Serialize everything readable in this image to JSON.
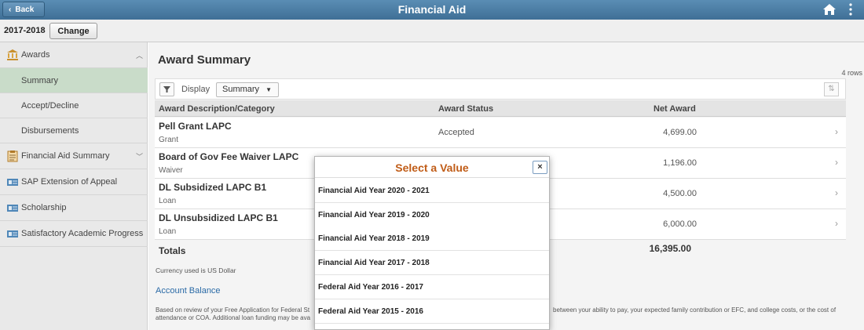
{
  "header": {
    "back_label": "Back",
    "title": "Financial Aid",
    "home_icon": "home-icon",
    "menu_icon": "kebab-menu-icon"
  },
  "yearbar": {
    "year": "2017-2018",
    "change_label": "Change"
  },
  "sidebar": {
    "awards_label": "Awards",
    "sub_items": [
      "Summary",
      "Accept/Decline",
      "Disbursements"
    ],
    "items": [
      "Financial Aid Summary",
      "SAP Extension of Appeal",
      "Scholarship",
      "Satisfactory Academic Progress"
    ]
  },
  "main": {
    "title": "Award Summary",
    "rows_count": "4 rows",
    "display_label": "Display",
    "display_value": "Summary",
    "columns": [
      "Award Description/Category",
      "Award Status",
      "Net Award"
    ],
    "rows": [
      {
        "desc": "Pell Grant LAPC",
        "cat": "Grant",
        "status": "Accepted",
        "amount": "4,699.00"
      },
      {
        "desc": "Board of Gov Fee Waiver LAPC",
        "cat": "Waiver",
        "status": "",
        "amount": "1,196.00"
      },
      {
        "desc": "DL Subsidized LAPC B1",
        "cat": "Loan",
        "status": "",
        "amount": "4,500.00"
      },
      {
        "desc": "DL Unsubsidized LAPC B1",
        "cat": "Loan",
        "status": "",
        "amount": "6,000.00"
      }
    ],
    "totals_label": "Totals",
    "totals_value": "16,395.00",
    "currency_note": "Currency used is US Dollar",
    "account_link": "Account Balance",
    "body_text_1": "Based on review of your Free Application for Federal St",
    "body_text_2": "between your ability to pay, your expected family contribution or EFC, and college costs, or the cost of",
    "body_text_3": "attendance or COA. Additional loan funding may be ava"
  },
  "modal": {
    "title": "Select a Value",
    "close_label": "×",
    "options": [
      "Financial Aid Year 2020 - 2021",
      "Financial Aid Year 2019 - 2020",
      "Financial Aid Year 2018 - 2019",
      "Financial Aid Year 2017 - 2018",
      "Federal Aid Year 2016 - 2017",
      "Federal Aid Year 2015 - 2016"
    ]
  },
  "colors": {
    "header": "#4a7ba3",
    "active_nav": "#c9dcc9",
    "modal_title": "#c05c17",
    "link": "#2a6aa6"
  }
}
